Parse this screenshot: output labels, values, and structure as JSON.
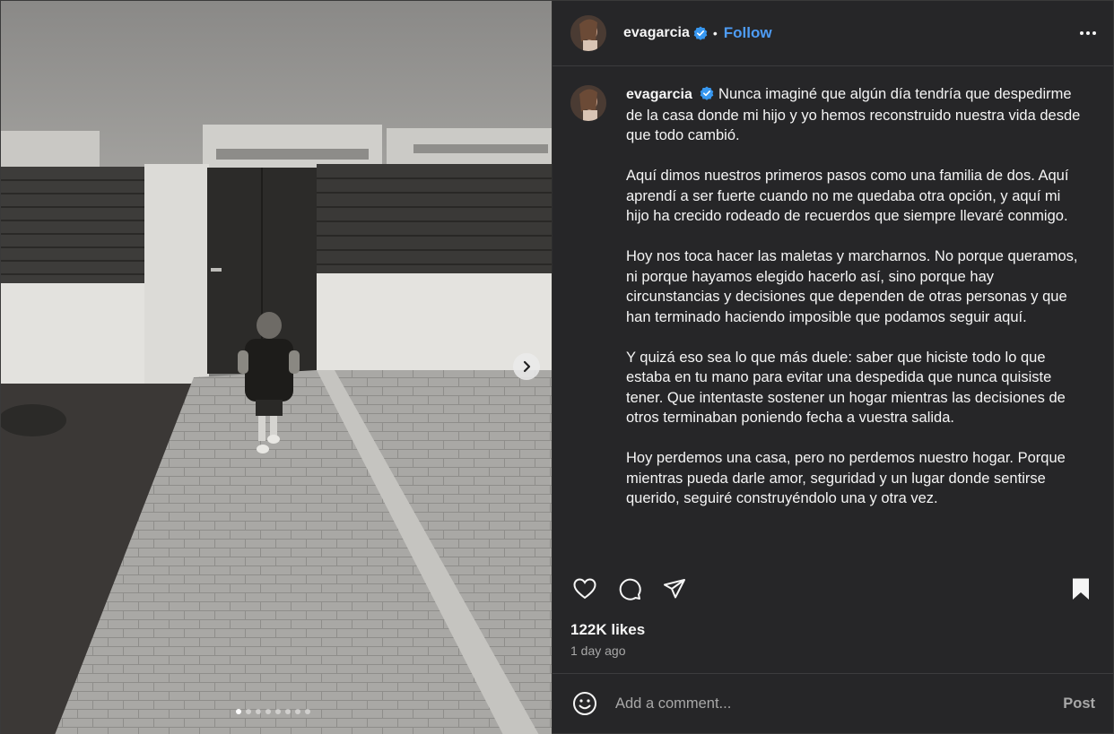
{
  "header": {
    "username": "evagarcia",
    "separator": "•",
    "follow_label": "Follow",
    "verified": true,
    "more_icon": "more-options-icon"
  },
  "carousel": {
    "total_slides": 8,
    "current_slide": 1,
    "next_icon": "chevron-right-icon"
  },
  "caption": {
    "username": "evagarcia",
    "paragraphs": [
      "Nunca imaginé que algún día tendría que despedirme de la casa donde mi hijo y yo hemos reconstruido nuestra vida desde que todo cambió.",
      "Aquí dimos nuestros primeros pasos como una familia de dos. Aquí aprendí a ser fuerte cuando no me quedaba otra opción, y aquí mi hijo ha crecido rodeado de recuerdos que siempre llevaré conmigo.",
      "Hoy nos toca hacer las maletas y marcharnos. No porque queramos, ni porque hayamos elegido hacerlo así, sino porque hay circunstancias y decisiones que dependen de otras personas y que han terminado haciendo imposible que podamos seguir aquí.",
      "Y quizá eso sea lo que más duele: saber que hiciste todo lo que estaba en tu mano para evitar una despedida que nunca quisiste tener. Que intentaste sostener un hogar mientras las decisiones de otros terminaban poniendo fecha a vuestra salida.",
      "Hoy perdemos una casa, pero no perdemos nuestro hogar. Porque mientras pueda darle amor, seguridad y un lugar donde sentirse querido, seguiré construyéndolo una y otra vez."
    ]
  },
  "actions": {
    "like_icon": "heart-icon",
    "comment_icon": "comment-icon",
    "share_icon": "share-icon",
    "save_icon": "bookmark-icon"
  },
  "stats": {
    "likes": "122K likes",
    "time": "1 day ago"
  },
  "comment": {
    "placeholder": "Add a comment...",
    "post_label": "Post",
    "emoji_icon": "emoji-icon"
  },
  "colors": {
    "panel_bg": "#262628",
    "accent": "#4e9cf5",
    "muted_text": "#a8a8a8"
  }
}
